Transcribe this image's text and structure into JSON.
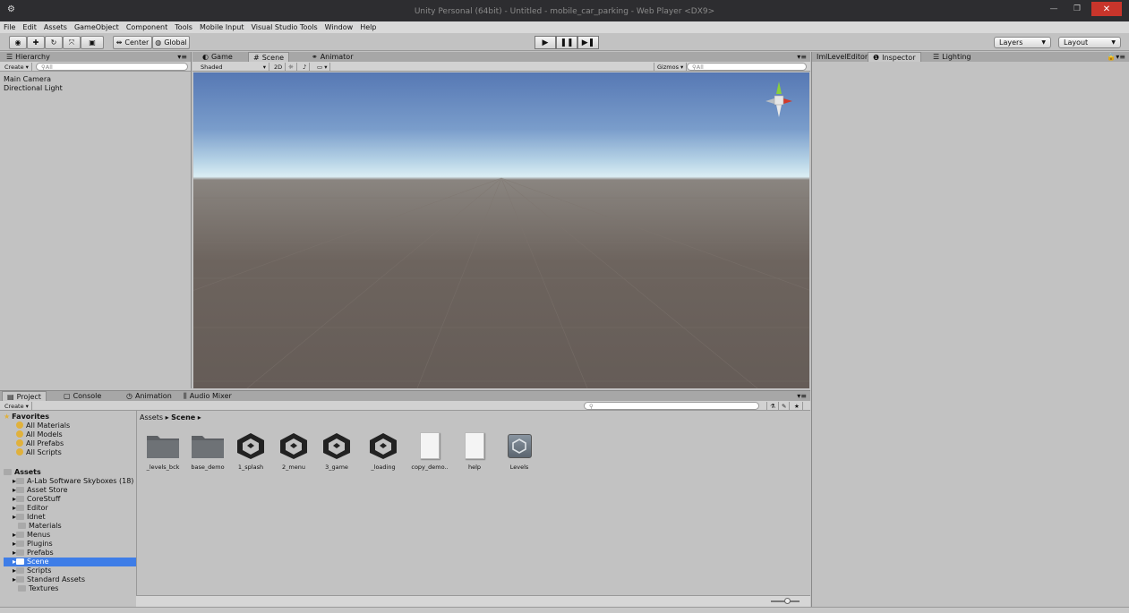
{
  "window": {
    "title": "Unity Personal (64bit) - Untitled - mobile_car_parking - Web Player <DX9>"
  },
  "menu": [
    "File",
    "Edit",
    "Assets",
    "GameObject",
    "Component",
    "Tools",
    "Mobile Input",
    "Visual Studio Tools",
    "Window",
    "Help"
  ],
  "toolbar": {
    "center_label": "Center",
    "global_label": "Global",
    "layers_label": "Layers",
    "layout_label": "Layout"
  },
  "hierarchy": {
    "tab": "Hierarchy",
    "create": "Create",
    "search_placeholder": "All",
    "items": [
      "Main Camera",
      "Directional Light"
    ]
  },
  "scene_view": {
    "tabs": [
      "Game",
      "Scene",
      "Animator"
    ],
    "shading": "Shaded",
    "mode_2d": "2D",
    "gizmos": "Gizmos",
    "search_placeholder": "All"
  },
  "inspector": {
    "tabs": [
      "ImlLevelEditor\\",
      "Inspector",
      "Lighting"
    ]
  },
  "project": {
    "tabs": [
      "Project",
      "Console",
      "Animation",
      "Audio Mixer"
    ],
    "create": "Create",
    "breadcrumb": [
      "Assets",
      "Scene"
    ],
    "favorites_label": "Favorites",
    "favorites": [
      "All Materials",
      "All Models",
      "All Prefabs",
      "All Scripts"
    ],
    "assets_label": "Assets",
    "folders": [
      "A-Lab Software Skyboxes (18)",
      "Asset Store",
      "CoreStuff",
      "Editor",
      "Idnet",
      "Materials",
      "Menus",
      "Plugins",
      "Prefabs",
      "Scene",
      "Scripts",
      "Standard Assets",
      "Textures"
    ],
    "selected_folder": "Scene",
    "assets": [
      {
        "name": "_levels_bck",
        "kind": "folder"
      },
      {
        "name": "base_demo",
        "kind": "folder"
      },
      {
        "name": "1_splash",
        "kind": "unity"
      },
      {
        "name": "2_menu",
        "kind": "unity"
      },
      {
        "name": "3_game",
        "kind": "unity"
      },
      {
        "name": "_loading",
        "kind": "unity"
      },
      {
        "name": "copy_demo..",
        "kind": "text"
      },
      {
        "name": "help",
        "kind": "text"
      },
      {
        "name": "Levels",
        "kind": "levels"
      }
    ]
  },
  "colors": {
    "selection": "#3e7de7",
    "sky_top": "#5d7fb8",
    "horizon": "#d7ecf4",
    "ground": "#6b625d"
  }
}
